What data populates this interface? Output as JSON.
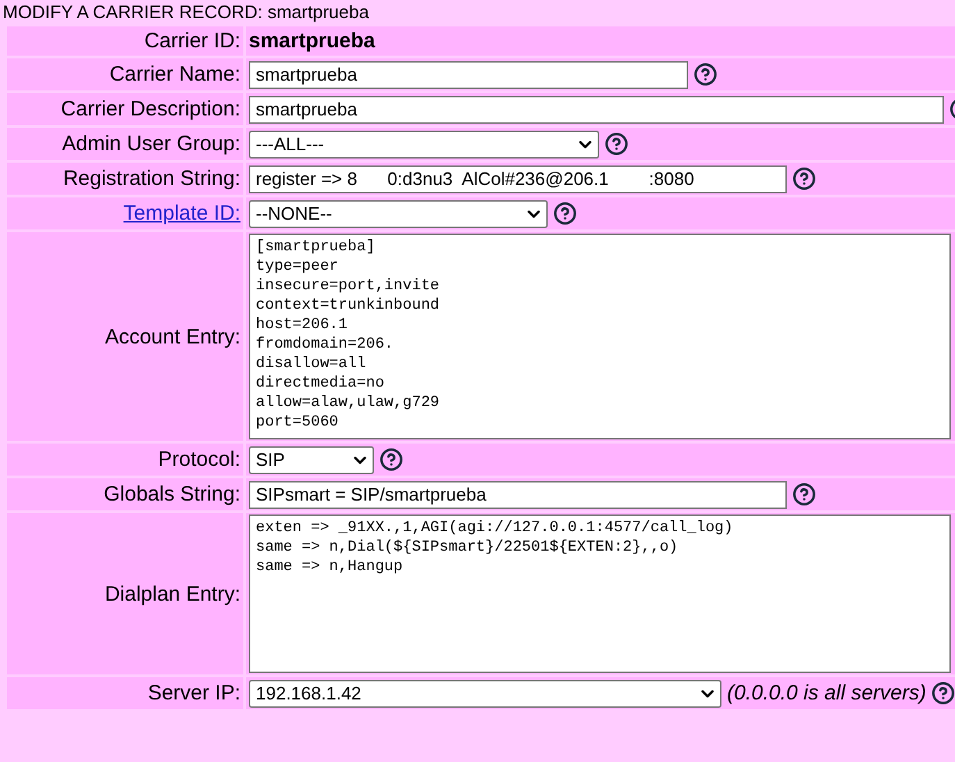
{
  "title": "MODIFY A CARRIER RECORD:",
  "title_name": "smartprueba",
  "rows": [
    {
      "kind": "static",
      "label": "Carrier ID:",
      "value": "smartprueba",
      "help": false
    },
    {
      "kind": "text",
      "label": "Carrier Name:",
      "value": "smartprueba",
      "help": true
    },
    {
      "kind": "text",
      "label": "Carrier Description:",
      "value": "smartprueba",
      "help": true
    },
    {
      "kind": "select",
      "label": "Admin User Group:",
      "value": "---ALL---",
      "help": true
    },
    {
      "kind": "text",
      "label": "Registration String:",
      "value": "register => 8      0:d3nu3  AlCol#236@206.1        :8080",
      "help": true
    },
    {
      "kind": "select",
      "label": "Template ID:",
      "link": true,
      "value": "--NONE--",
      "help": true
    },
    {
      "kind": "textarea",
      "label": "Account Entry:",
      "value": "[smartprueba]\ntype=peer\ninsecure=port,invite\ncontext=trunkinbound\nhost=206.1\nfromdomain=206.\ndisallow=all\ndirectmedia=no\nallow=alaw,ulaw,g729\nport=5060",
      "help": false
    },
    {
      "kind": "select",
      "label": "Protocol:",
      "value": "SIP",
      "help": true
    },
    {
      "kind": "text",
      "label": "Globals String:",
      "value": "SIPsmart = SIP/smartprueba",
      "help": true
    },
    {
      "kind": "textarea",
      "label": "Dialplan Entry:",
      "value": "exten => _91XX.,1,AGI(agi://127.0.0.1:4577/call_log)\nsame => n,Dial(${SIPsmart}/22501${EXTEN:2},,o)\nsame => n,Hangup",
      "help": false
    },
    {
      "kind": "select",
      "label": "Server IP:",
      "value": "192.168.1.42",
      "note": "(0.0.0.0 is all servers)",
      "help": true
    }
  ]
}
